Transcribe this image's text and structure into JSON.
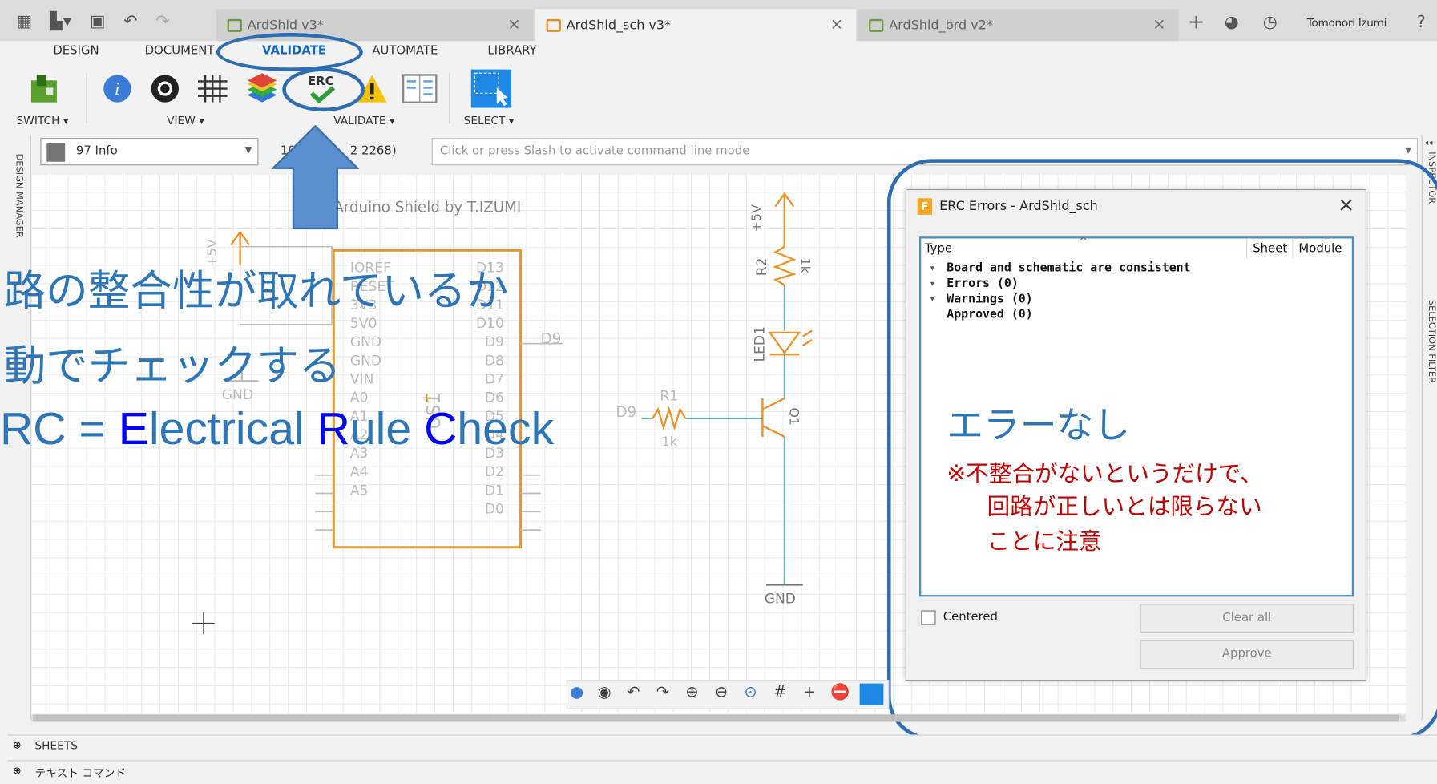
{
  "window": {
    "tabs": [
      {
        "label": "ArdShld v3*"
      },
      {
        "label": "ArdShld_sch v3*"
      },
      {
        "label": "ArdShld_brd v2*"
      }
    ],
    "user": "Tomonori Izumi",
    "icons": [
      "grid-menu-icon",
      "file-icon",
      "save-icon",
      "undo-icon",
      "redo-icon",
      "new-tab-icon",
      "job-status-icon",
      "clock-icon",
      "help-icon"
    ]
  },
  "ribbon": {
    "tabs": [
      "DESIGN",
      "DOCUMENT",
      "VALIDATE",
      "AUTOMATE",
      "LIBRARY"
    ],
    "active_tab": "VALIDATE",
    "groups": {
      "switch": "SWITCH ▾",
      "view": "VIEW ▾",
      "validate": "VALIDATE ▾",
      "select": "SELECT ▾"
    },
    "erc_label": "ERC"
  },
  "layer": {
    "name": "97 Info",
    "swatch_color": "#777777"
  },
  "coord": "10",
  "coord_tail": "2 2268)",
  "command_placeholder": "Click or press Slash to activate command line mode",
  "side": {
    "left": "DESIGN MANAGER",
    "right_top": "INSPECTOR",
    "right_mid": "SELECTION FILTER"
  },
  "schematic": {
    "title": "Arduino Shield by T.IZUMI",
    "supply": "+5V",
    "gnd": "GND",
    "part_name": "US1",
    "left_pins": [
      "IOREF",
      "RESET",
      "3V3",
      "5V0",
      "GND",
      "GND",
      "VIN",
      "A0",
      "A1",
      "A2",
      "A3",
      "A4",
      "A5"
    ],
    "right_pins": [
      "D13",
      "D12",
      "D11",
      "D10",
      "D9",
      "D8",
      "D7",
      "D6",
      "D5",
      "D4",
      "D3",
      "D2",
      "D1",
      "D0"
    ],
    "net_d9": "D9",
    "r1": {
      "name": "R1",
      "value": "1k"
    },
    "r2": {
      "name": "R2",
      "value": "1k"
    },
    "led": "LED1",
    "q1": "Q1"
  },
  "dialog": {
    "title": "ERC Errors - ArdShld_sch",
    "columns": [
      "Type",
      "Sheet",
      "Module"
    ],
    "rows": [
      "Board and schematic are consistent",
      "Errors (0)",
      "Warnings (0)",
      "Approved (0)"
    ],
    "centered_label": "Centered",
    "clear_all": "Clear all",
    "approve": "Approve"
  },
  "annotations": {
    "line1": "路の整合性が取れているか",
    "line2": "動でチェックする",
    "erc_prefix": "RC = ",
    "erc_E": "E",
    "erc_lectrical": "lectrical ",
    "erc_R": "R",
    "erc_ule": "ule ",
    "erc_C": "C",
    "erc_heck": "heck",
    "no_error": "エラーなし",
    "note1": "※不整合がないというだけで、",
    "note2": "回路が正しいとは限らない",
    "note3": "ことに注意",
    "accent_blue": "#2e75b6",
    "letter_blue": "#0000ff",
    "note_red": "#c00000"
  },
  "bottom": {
    "sheets": "SHEETS",
    "text_cmd": "テキスト コマンド"
  }
}
